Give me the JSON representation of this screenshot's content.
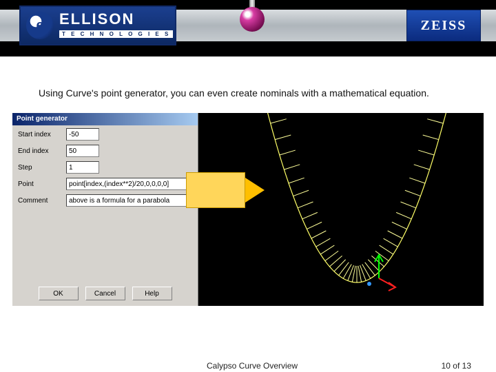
{
  "header": {
    "ellison_big": "ELLISON",
    "ellison_small": "T E C H N O L O G I E S",
    "zeiss": "ZEISS"
  },
  "intro_text": "Using Curve's point generator, you can even create nominals with a mathematical equation.",
  "dialog": {
    "title": "Point generator",
    "labels": {
      "start": "Start index",
      "end": "End index",
      "step": "Step",
      "point": "Point",
      "comment": "Comment"
    },
    "values": {
      "start": "-50",
      "end": "50",
      "step": "1",
      "point": "point[index,(index**2)/20,0,0,0,0]",
      "comment": "above is a formula for a parabola"
    },
    "buttons": {
      "ok": "OK",
      "cancel": "Cancel",
      "help": "Help"
    }
  },
  "footer": {
    "title": "Calypso Curve Overview",
    "page": "10 of 13"
  }
}
